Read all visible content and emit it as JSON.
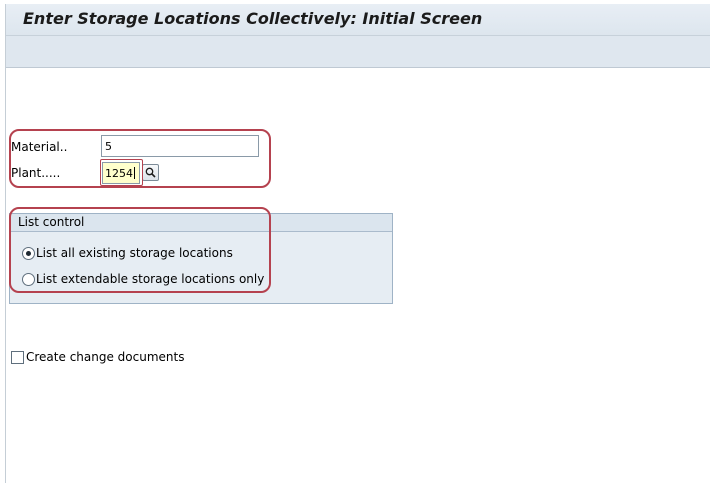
{
  "header": {
    "title": "Enter Storage Locations Collectively: Initial Screen"
  },
  "form": {
    "material": {
      "label": "Material..",
      "value": "5"
    },
    "plant": {
      "label": "Plant.....",
      "value": "1254"
    }
  },
  "list_control": {
    "title": "List control",
    "options": [
      {
        "label": "List all existing storage locations",
        "selected": true
      },
      {
        "label": "List extendable storage locations only",
        "selected": false
      }
    ]
  },
  "create_change_documents": {
    "label": "Create change documents",
    "checked": false
  },
  "icons": {
    "value_help": "magnifier-icon"
  },
  "colors": {
    "highlight": "#b5424f",
    "required_field": "#ffffcc",
    "group_box": "#e6edf3",
    "title_bar": "#e3eaf1"
  }
}
